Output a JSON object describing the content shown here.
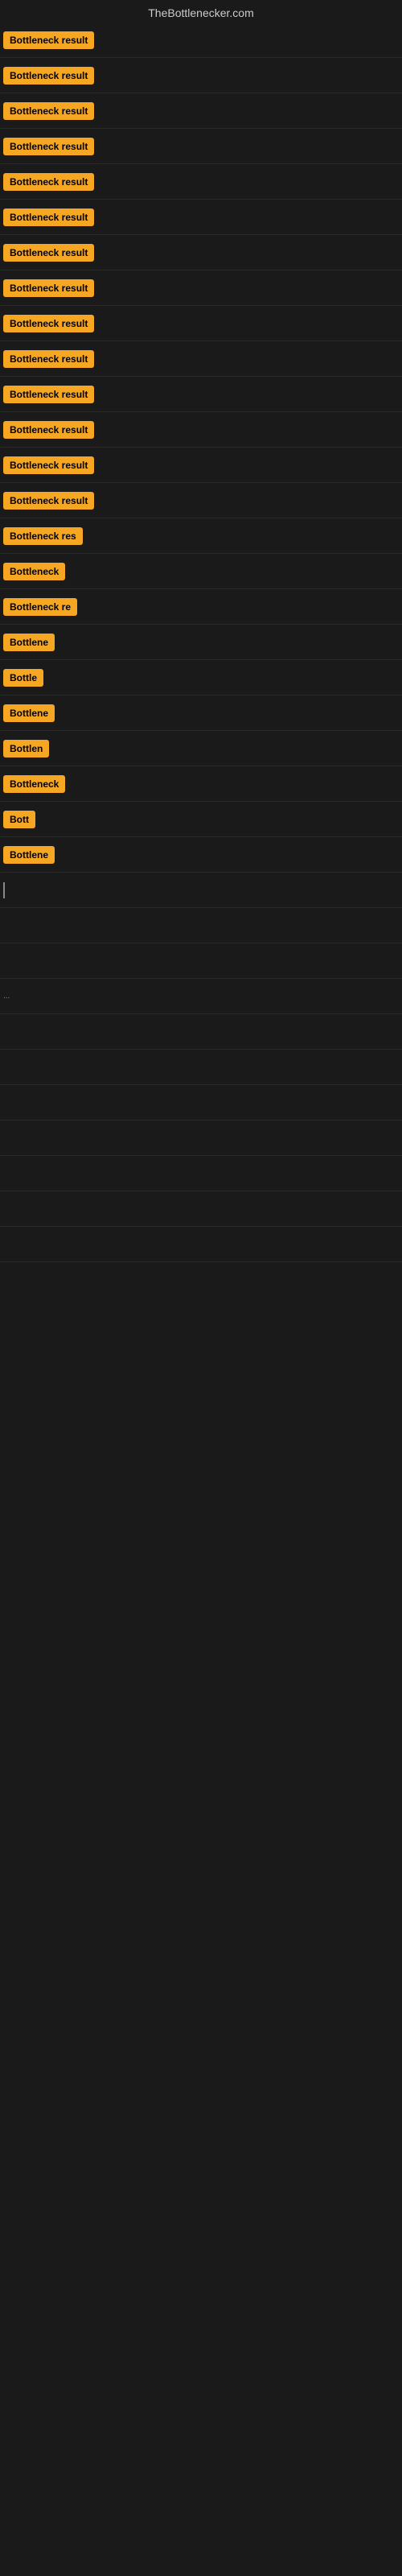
{
  "header": {
    "title": "TheBottlenecker.com"
  },
  "rows": [
    {
      "id": 1,
      "label": "Bottleneck result",
      "width": 120
    },
    {
      "id": 2,
      "label": "Bottleneck result",
      "width": 120
    },
    {
      "id": 3,
      "label": "Bottleneck result",
      "width": 120
    },
    {
      "id": 4,
      "label": "Bottleneck result",
      "width": 120
    },
    {
      "id": 5,
      "label": "Bottleneck result",
      "width": 120
    },
    {
      "id": 6,
      "label": "Bottleneck result",
      "width": 120
    },
    {
      "id": 7,
      "label": "Bottleneck result",
      "width": 120
    },
    {
      "id": 8,
      "label": "Bottleneck result",
      "width": 120
    },
    {
      "id": 9,
      "label": "Bottleneck result",
      "width": 120
    },
    {
      "id": 10,
      "label": "Bottleneck result",
      "width": 120
    },
    {
      "id": 11,
      "label": "Bottleneck result",
      "width": 120
    },
    {
      "id": 12,
      "label": "Bottleneck result",
      "width": 120
    },
    {
      "id": 13,
      "label": "Bottleneck result",
      "width": 120
    },
    {
      "id": 14,
      "label": "Bottleneck result",
      "width": 120
    },
    {
      "id": 15,
      "label": "Bottleneck res",
      "width": 100
    },
    {
      "id": 16,
      "label": "Bottleneck",
      "width": 75
    },
    {
      "id": 17,
      "label": "Bottleneck re",
      "width": 90
    },
    {
      "id": 18,
      "label": "Bottlene",
      "width": 65
    },
    {
      "id": 19,
      "label": "Bottle",
      "width": 50
    },
    {
      "id": 20,
      "label": "Bottlene",
      "width": 65
    },
    {
      "id": 21,
      "label": "Bottlen",
      "width": 60
    },
    {
      "id": 22,
      "label": "Bottleneck",
      "width": 75
    },
    {
      "id": 23,
      "label": "Bott",
      "width": 40
    },
    {
      "id": 24,
      "label": "Bottlene",
      "width": 65
    },
    {
      "id": 25,
      "label": "",
      "width": 0,
      "cursor": true
    },
    {
      "id": 26,
      "label": "",
      "width": 0
    },
    {
      "id": 27,
      "label": "",
      "width": 0
    },
    {
      "id": 28,
      "label": "...",
      "width": 0,
      "dot": true
    },
    {
      "id": 29,
      "label": "",
      "width": 0
    },
    {
      "id": 30,
      "label": "",
      "width": 0
    },
    {
      "id": 31,
      "label": "",
      "width": 0
    },
    {
      "id": 32,
      "label": "",
      "width": 0
    },
    {
      "id": 33,
      "label": "",
      "width": 0
    },
    {
      "id": 34,
      "label": "",
      "width": 0
    },
    {
      "id": 35,
      "label": "",
      "width": 0
    }
  ]
}
